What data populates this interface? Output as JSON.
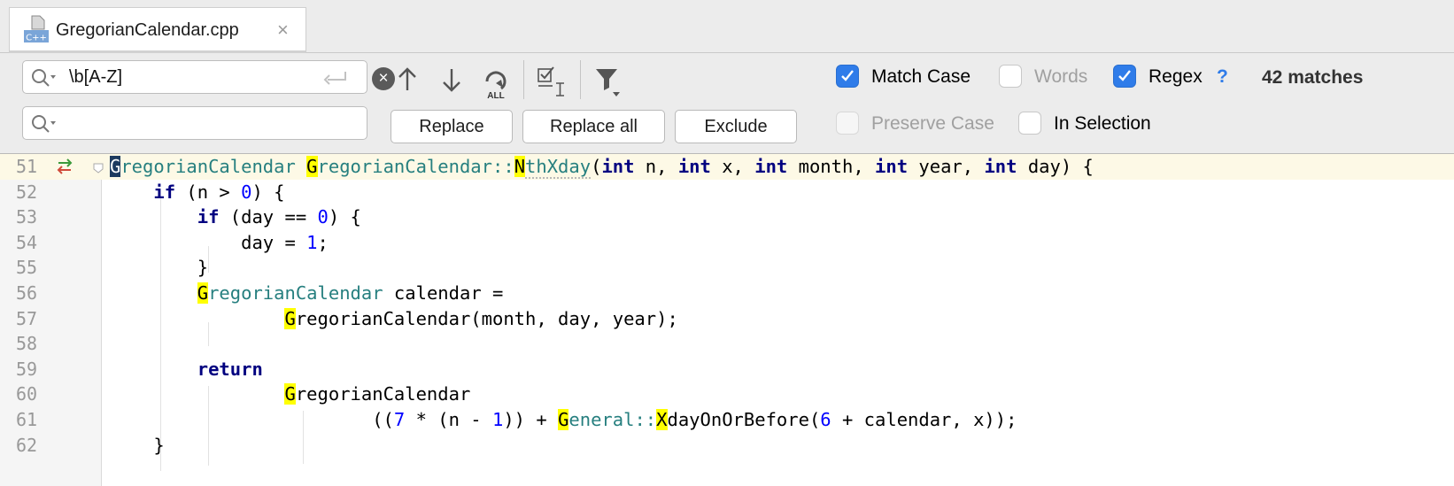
{
  "tab": {
    "file_icon_label": "C++",
    "title": "GregorianCalendar.cpp",
    "close_glyph": "×"
  },
  "find": {
    "search_value": "\\b[A-Z]",
    "replace_value": "",
    "replace_label": "Replace",
    "replace_all_label": "Replace all",
    "exclude_label": "Exclude",
    "all_label": "ALL",
    "match_case_label": "Match Case",
    "match_case_checked": true,
    "words_label": "Words",
    "words_checked": false,
    "regex_label": "Regex",
    "regex_checked": true,
    "help_label": "?",
    "matches_label": "42 matches",
    "preserve_case_label": "Preserve Case",
    "preserve_case_checked": false,
    "in_selection_label": "In Selection",
    "in_selection_checked": false
  },
  "editor": {
    "current_line": "51",
    "lines": [
      {
        "num": "51"
      },
      {
        "num": "52"
      },
      {
        "num": "53"
      },
      {
        "num": "54"
      },
      {
        "num": "55"
      },
      {
        "num": "56"
      },
      {
        "num": "57"
      },
      {
        "num": "58"
      },
      {
        "num": "59"
      },
      {
        "num": "60"
      },
      {
        "num": "61"
      },
      {
        "num": "62"
      }
    ],
    "tokens": {
      "t51a": "G",
      "t51b": "regorianCalendar",
      "t51c": " ",
      "t51d": "G",
      "t51e": "regorianCalendar",
      "t51f": "::",
      "t51g": "N",
      "t51h": "thXday",
      "t51i": "(",
      "t51j": "int",
      "t51k": " n, ",
      "t51l": "int",
      "t51m": " x, ",
      "t51n": "int",
      "t51o": " month, ",
      "t51p": "int",
      "t51q": " year, ",
      "t51r": "int",
      "t51s": " day) {",
      "t52a": "    ",
      "t52b": "if",
      "t52c": " (n > ",
      "t52d": "0",
      "t52e": ") {",
      "t53a": "        ",
      "t53b": "if",
      "t53c": " (day == ",
      "t53d": "0",
      "t53e": ") {",
      "t54a": "            day = ",
      "t54b": "1",
      "t54c": ";",
      "t55a": "        }",
      "t56a": "        ",
      "t56b": "G",
      "t56c": "regorianCalendar",
      "t56d": " calendar =",
      "t57a": "                ",
      "t57b": "G",
      "t57c": "regorianCalendar(month, day, year);",
      "t59a": "        ",
      "t59b": "return",
      "t60a": "                ",
      "t60b": "G",
      "t60c": "regorianCalendar",
      "t61a": "                        ((",
      "t61b": "7",
      "t61c": " * (n - ",
      "t61d": "1",
      "t61e": ")) + ",
      "t61f": "G",
      "t61g": "eneral",
      "t61h": "::",
      "t61i": "X",
      "t61j": "dayOnOrBefore(",
      "t61k": "6",
      "t61l": " + calendar, x));",
      "t62a": "    }"
    }
  }
}
